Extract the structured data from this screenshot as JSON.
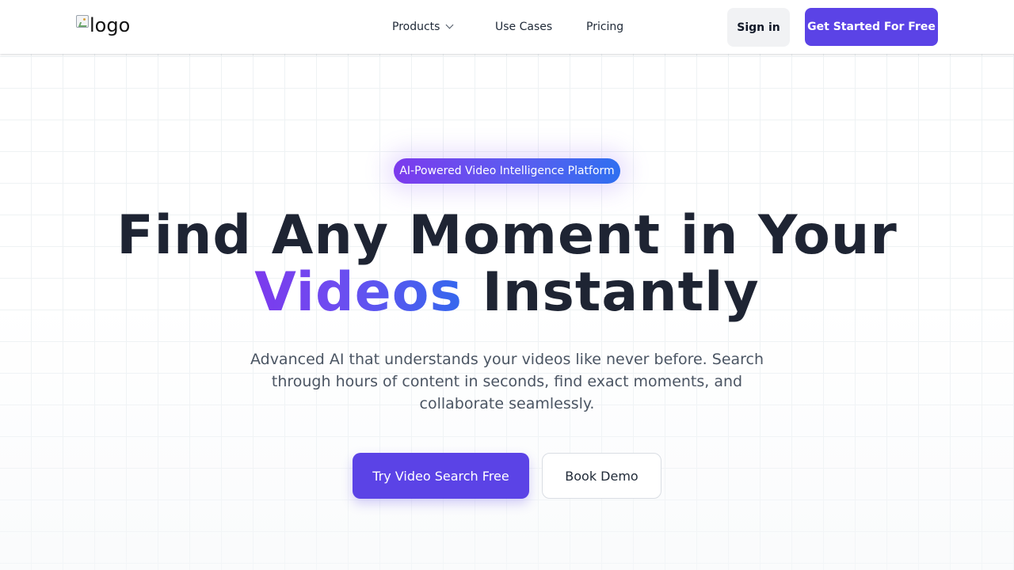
{
  "header": {
    "logo_alt": "logo",
    "nav": {
      "products": "Products",
      "use_cases": "Use Cases",
      "pricing": "Pricing"
    },
    "sign_in": "Sign in",
    "get_started": "Get Started For Free"
  },
  "hero": {
    "badge": "AI-Powered Video Intelligence Platform",
    "title_line1": "Find Any Moment in Your",
    "title_line2_highlight": "Videos",
    "title_line2_rest": " Instantly",
    "subtitle": "Advanced AI that understands your videos like never before. Search through hours of content in seconds, find exact moments, and collaborate seamlessly.",
    "primary_cta": "Try Video Search Free",
    "secondary_cta": "Book Demo"
  },
  "colors": {
    "primary": "#5b43e6",
    "gradient_start": "#7c3aed",
    "gradient_end": "#2f6ff0",
    "heading": "#1e2433",
    "body_text": "#4b5563"
  },
  "icons": {
    "logo": "broken-image-icon",
    "products_dropdown": "chevron-down-icon"
  }
}
